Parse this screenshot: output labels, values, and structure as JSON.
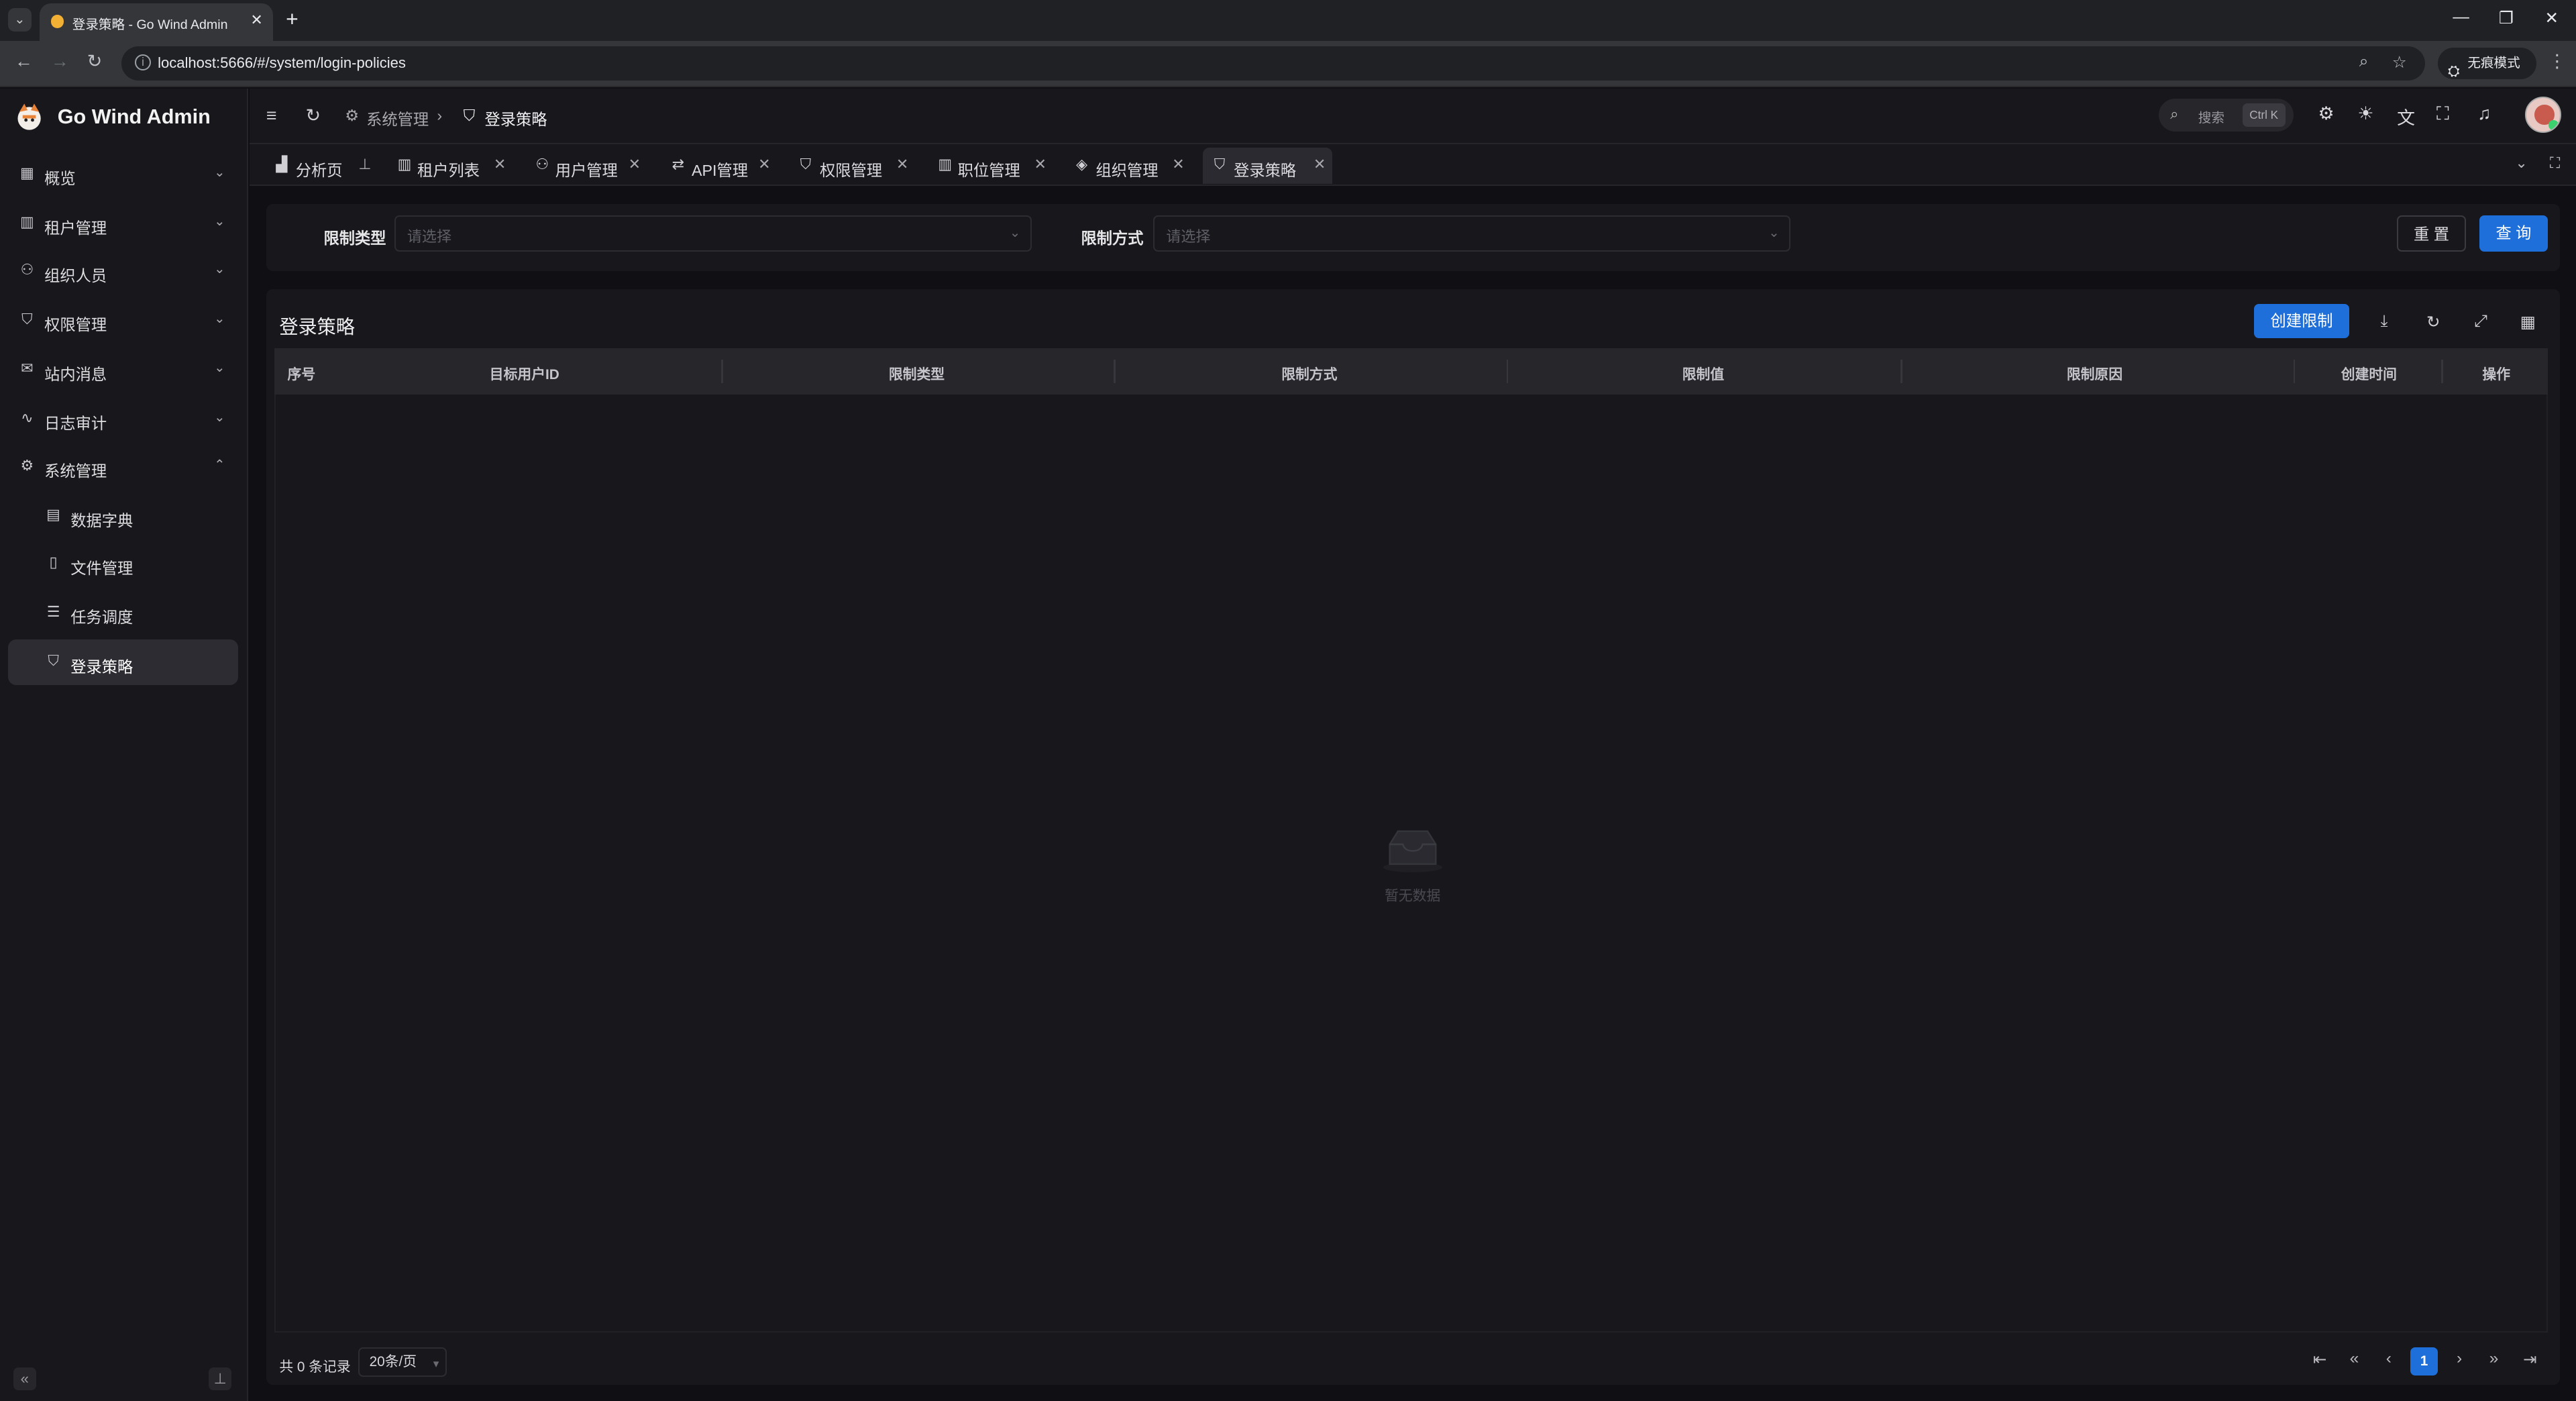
{
  "browser": {
    "tab_title": "登录策略 - Go Wind Admin",
    "url": "localhost:5666/#/system/login-policies",
    "incognito_label": "无痕模式"
  },
  "app": {
    "brand": "Go Wind Admin"
  },
  "sidebar": {
    "items": [
      {
        "label": "概览",
        "icon": "dashboard-icon"
      },
      {
        "label": "租户管理",
        "icon": "tenant-icon"
      },
      {
        "label": "组织人员",
        "icon": "users-icon"
      },
      {
        "label": "权限管理",
        "icon": "shield-icon"
      },
      {
        "label": "站内消息",
        "icon": "mail-icon"
      },
      {
        "label": "日志审计",
        "icon": "activity-icon"
      },
      {
        "label": "系统管理",
        "icon": "gear-icon"
      }
    ],
    "sub_items": [
      {
        "label": "数据字典",
        "icon": "book-icon"
      },
      {
        "label": "文件管理",
        "icon": "file-icon"
      },
      {
        "label": "任务调度",
        "icon": "task-icon"
      },
      {
        "label": "登录策略",
        "icon": "shield-check-icon"
      }
    ]
  },
  "header": {
    "breadcrumb_parent": "系统管理",
    "breadcrumb_current": "登录策略",
    "search_label": "搜索",
    "search_shortcut": "Ctrl K"
  },
  "page_tabs": [
    {
      "label": "分析页"
    },
    {
      "label": "租户列表"
    },
    {
      "label": "用户管理"
    },
    {
      "label": "API管理"
    },
    {
      "label": "权限管理"
    },
    {
      "label": "职位管理"
    },
    {
      "label": "组织管理"
    },
    {
      "label": "登录策略"
    }
  ],
  "filter": {
    "type_label": "限制类型",
    "type_placeholder": "请选择",
    "method_label": "限制方式",
    "method_placeholder": "请选择",
    "reset_label": "重 置",
    "query_label": "查 询"
  },
  "table": {
    "title": "登录策略",
    "create_label": "创建限制",
    "columns": [
      "序号",
      "目标用户ID",
      "限制类型",
      "限制方式",
      "限制值",
      "限制原因",
      "创建时间",
      "操作"
    ],
    "empty_text": "暂无数据",
    "total_text": "共 0 条记录",
    "page_size": "20条/页",
    "current_page": "1"
  },
  "colors": {
    "primary": "#1e6fd9",
    "background": "#101014",
    "card": "#18181c"
  }
}
